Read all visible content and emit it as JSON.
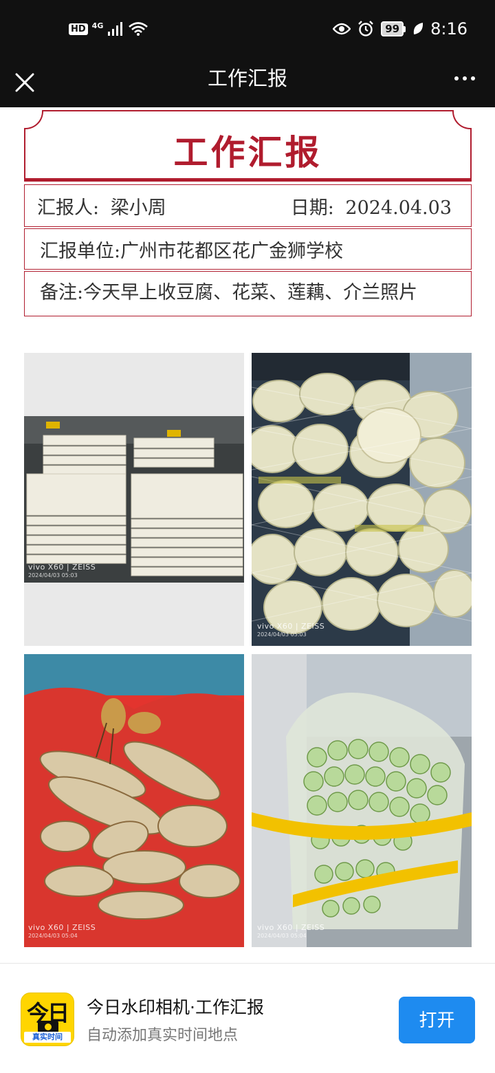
{
  "status_bar": {
    "hd": "HD",
    "network": "4G",
    "battery": "99",
    "time": "8:16"
  },
  "header": {
    "title": "工作汇报"
  },
  "report": {
    "title": "工作汇报",
    "reporter_label": "汇报人:",
    "reporter": "梁小周",
    "date_label": "日期:",
    "date": "2024.04.03",
    "unit_label": "汇报单位:",
    "unit": "广州市花都区花广金狮学校",
    "note_label": "备注:",
    "note": "今天早上收豆腐、花菜、莲藕、介兰照片"
  },
  "photos": [
    {
      "brand": "vivo X60 | ZEISS",
      "time": "2024/04/03 05:03"
    },
    {
      "brand": "vivo X60 | ZEISS",
      "time": "2024/04/03 05:03"
    },
    {
      "brand": "vivo X60 | ZEISS",
      "time": "2024/04/03 05:04"
    },
    {
      "brand": "vivo X60 | ZEISS",
      "time": "2024/04/03 05:04"
    }
  ],
  "banner": {
    "icon_text": "今日",
    "icon_sub": "真实时间",
    "title": "今日水印相机·工作汇报",
    "subtitle": "自动添加真实时间地点",
    "open_label": "打开"
  },
  "colors": {
    "accent_red": "#b01c2e",
    "open_blue": "#1e8bf0",
    "app_yellow": "#ffd500"
  }
}
